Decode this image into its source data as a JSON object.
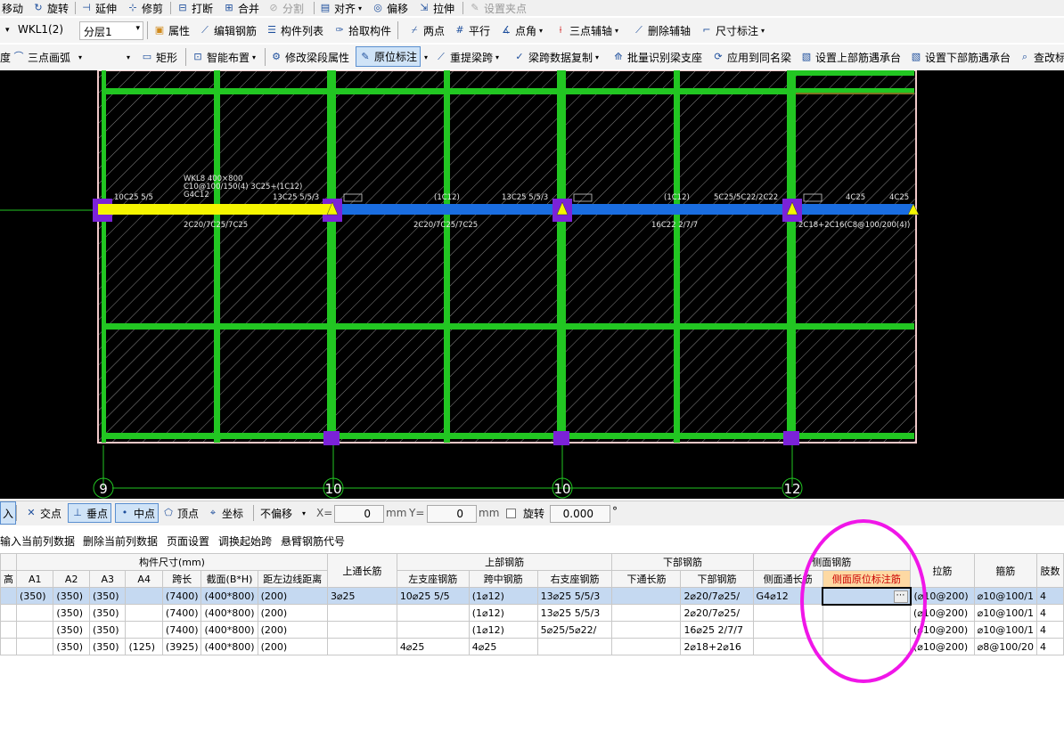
{
  "toolbar1": {
    "move": "移动",
    "rotate": "旋转",
    "extend": "延伸",
    "trim": "修剪",
    "break": "打断",
    "merge": "合并",
    "split": "分割",
    "align": "对齐",
    "offset": "偏移",
    "stretch": "拉伸",
    "set_grip": "设置夹点"
  },
  "toolbar2": {
    "beam": "WKL1(2)",
    "floor": "分层1",
    "property": "属性",
    "edit_rebar": "编辑钢筋",
    "component_list": "构件列表",
    "pick": "拾取构件",
    "two_points": "两点",
    "parallel": "平行",
    "point_angle": "点角",
    "three_point_axis": "三点辅轴",
    "delete_axis": "删除辅轴",
    "dimension": "尺寸标注"
  },
  "toolbar3": {
    "three_point_arc": "三点画弧",
    "rect": "矩形",
    "smart_layout": "智能布置",
    "modify_span": "修改梁段属性",
    "in_situ": "原位标注",
    "re_span": "重提梁跨",
    "copy_data": "梁跨数据复制",
    "batch_identify": "批量识别梁支座",
    "apply_same": "应用到同名梁",
    "set_top": "设置上部筋遇承台",
    "set_bottom": "设置下部筋遇承台",
    "check": "查改标"
  },
  "canvas": {
    "axis_labels": [
      "9",
      "10",
      "10",
      "12"
    ],
    "annot": {
      "a1": "WKL8 400×800",
      "a2": "C10@100/150(4) 3C25+(1C12)",
      "a3": "G4C12",
      "a4": "10C25 5/5",
      "a5": "13C25 5/5/3",
      "a6": "(1C12)",
      "a7": "13C25 5/5/3",
      "a8": "(1C12)",
      "a9": "5C25/5C22/2C22",
      "a10": "4C25",
      "a11": "4C25",
      "b1": "2C20/7C25/7C25",
      "b2": "2C20/7C25/7C25",
      "b3": "16C22 2/7/7",
      "b4": "2C18+2C16(C8@100/200(4))"
    }
  },
  "snapbar": {
    "in": "入",
    "intersect": "交点",
    "perp": "垂点",
    "mid": "中点",
    "vertex": "顶点",
    "coord": "坐标",
    "offset": "不偏移",
    "x_label": "X=",
    "x_val": "0",
    "mm1": "mm",
    "y_label": "Y=",
    "y_val": "0",
    "mm2": "mm",
    "rotate": "旋转",
    "rotate_val": "0.000",
    "deg": "°"
  },
  "tablebar": {
    "b1": "输入当前列数据",
    "b2": "删除当前列数据",
    "b3": "页面设置",
    "b4": "调换起始跨",
    "b5": "悬臂钢筋代号"
  },
  "table": {
    "group_headers": {
      "dims": "构件尺寸(mm)",
      "top_long": "上通长筋",
      "top_rebar": "上部钢筋",
      "bottom_rebar": "下部钢筋",
      "side_rebar": "侧面钢筋",
      "stirrup": "箍筋",
      "limbs": "肢数"
    },
    "headers": [
      "高",
      "A1",
      "A2",
      "A3",
      "A4",
      "跨长",
      "截面(B*H)",
      "距左边线距离",
      "左支座钢筋",
      "跨中钢筋",
      "右支座钢筋",
      "下通长筋",
      "下部钢筋",
      "侧面通长筋",
      "侧面原位标注筋",
      "拉筋"
    ],
    "rows": [
      [
        "",
        "(350)",
        "(350)",
        "(350)",
        "",
        "(7400)",
        "(400*800)",
        "(200)",
        "3⌀25",
        "10⌀25 5/5",
        "(1⌀12)",
        "13⌀25 5/5/3",
        "",
        "2⌀20/7⌀25/",
        "G4⌀12",
        "",
        "(⌀10@200)",
        "⌀10@100/1",
        "4"
      ],
      [
        "",
        "",
        "(350)",
        "(350)",
        "",
        "(7400)",
        "(400*800)",
        "(200)",
        "",
        "",
        "(1⌀12)",
        "13⌀25 5/5/3",
        "",
        "2⌀20/7⌀25/",
        "",
        "",
        "(⌀10@200)",
        "⌀10@100/1",
        "4"
      ],
      [
        "",
        "",
        "(350)",
        "(350)",
        "",
        "(7400)",
        "(400*800)",
        "(200)",
        "",
        "",
        "(1⌀12)",
        "5⌀25/5⌀22/",
        "",
        "16⌀25 2/7/7",
        "",
        "",
        "(⌀10@200)",
        "⌀10@100/1",
        "4"
      ],
      [
        "",
        "",
        "(350)",
        "(350)",
        "(125)",
        "(3925)",
        "(400*800)",
        "(200)",
        "",
        "4⌀25",
        "4⌀25",
        "",
        "",
        "2⌀18+2⌀16",
        "",
        "",
        "(⌀10@200)",
        "⌀8@100/20",
        "4"
      ]
    ]
  }
}
